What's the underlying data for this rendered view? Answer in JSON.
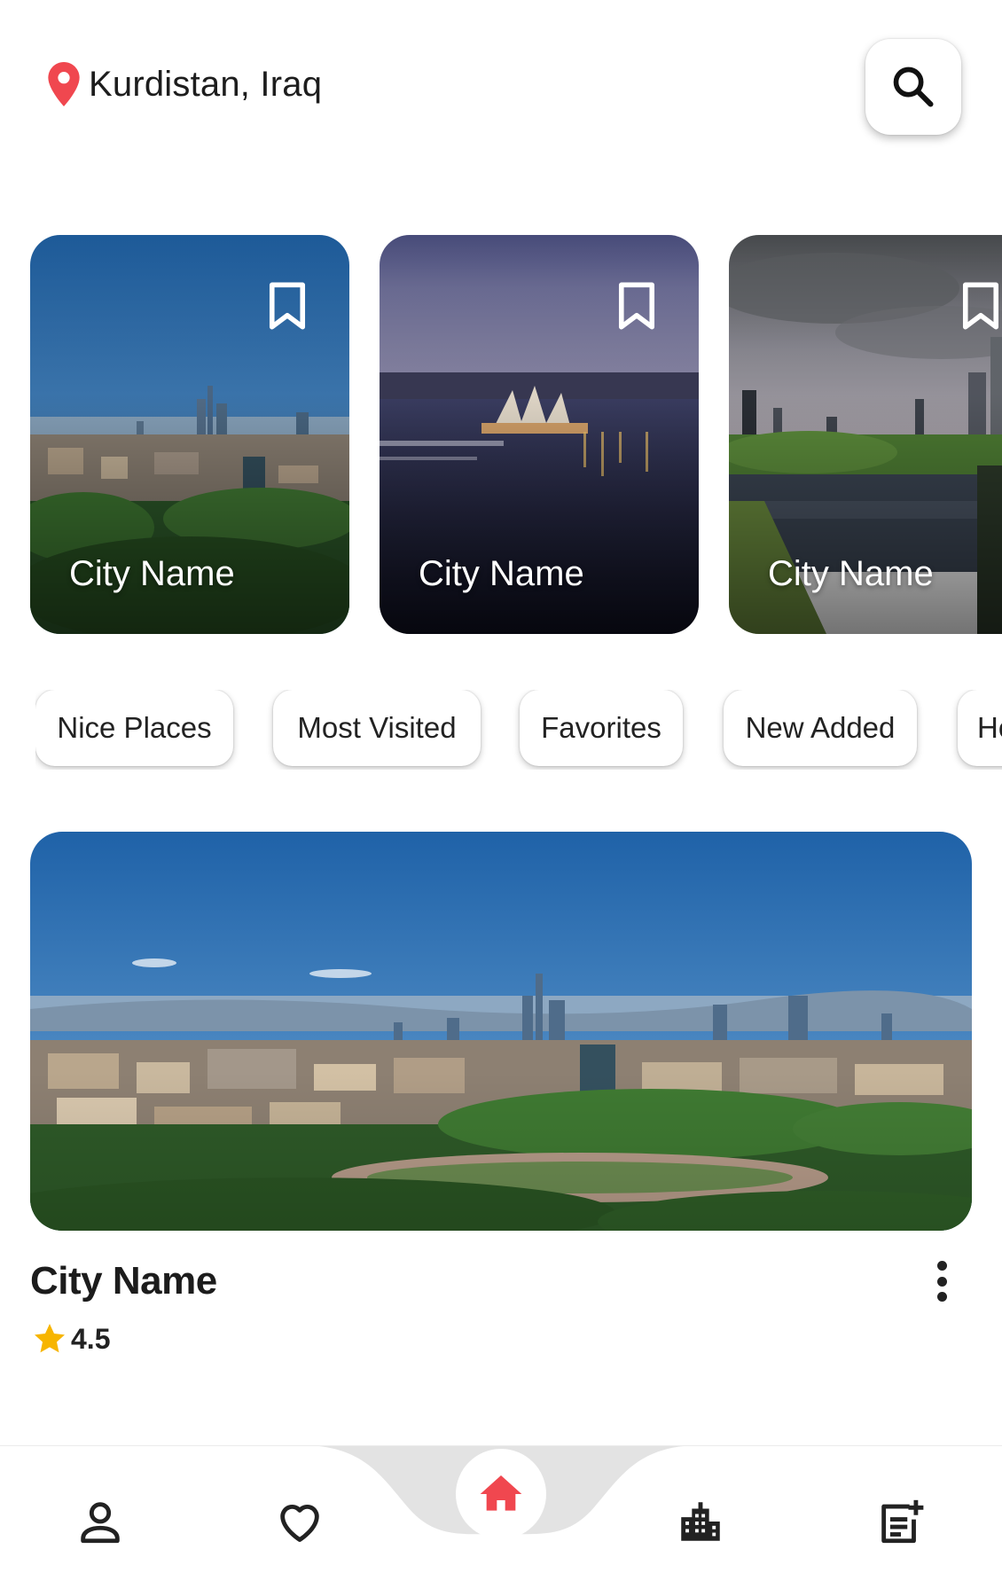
{
  "header": {
    "location": "Kurdistan, Iraq",
    "location_icon": "location-pin-icon",
    "search_icon": "search-icon",
    "accent": "#f0474f"
  },
  "cities": [
    {
      "name": "City Name",
      "bookmark_icon": "bookmark-outline-icon",
      "scene": "milan-skyline"
    },
    {
      "name": "City Name",
      "bookmark_icon": "bookmark-outline-icon",
      "scene": "sydney-opera-house"
    },
    {
      "name": "City Name",
      "bookmark_icon": "bookmark-outline-icon",
      "scene": "chicago-lakeside"
    }
  ],
  "chips": [
    {
      "label": "Nice Places"
    },
    {
      "label": "Most Visited"
    },
    {
      "label": "Favorites"
    },
    {
      "label": "New Added"
    },
    {
      "label": "He"
    }
  ],
  "featured": {
    "name": "City Name",
    "rating": "4.5",
    "star_color": "#f7b500",
    "more_icon": "more-vertical-icon"
  },
  "bottom_nav": {
    "items": [
      {
        "icon": "person-icon"
      },
      {
        "icon": "heart-icon"
      },
      {
        "icon": "home-icon",
        "active": true
      },
      {
        "icon": "city-icon"
      },
      {
        "icon": "add-post-icon"
      }
    ],
    "active_color": "#f0474f"
  }
}
